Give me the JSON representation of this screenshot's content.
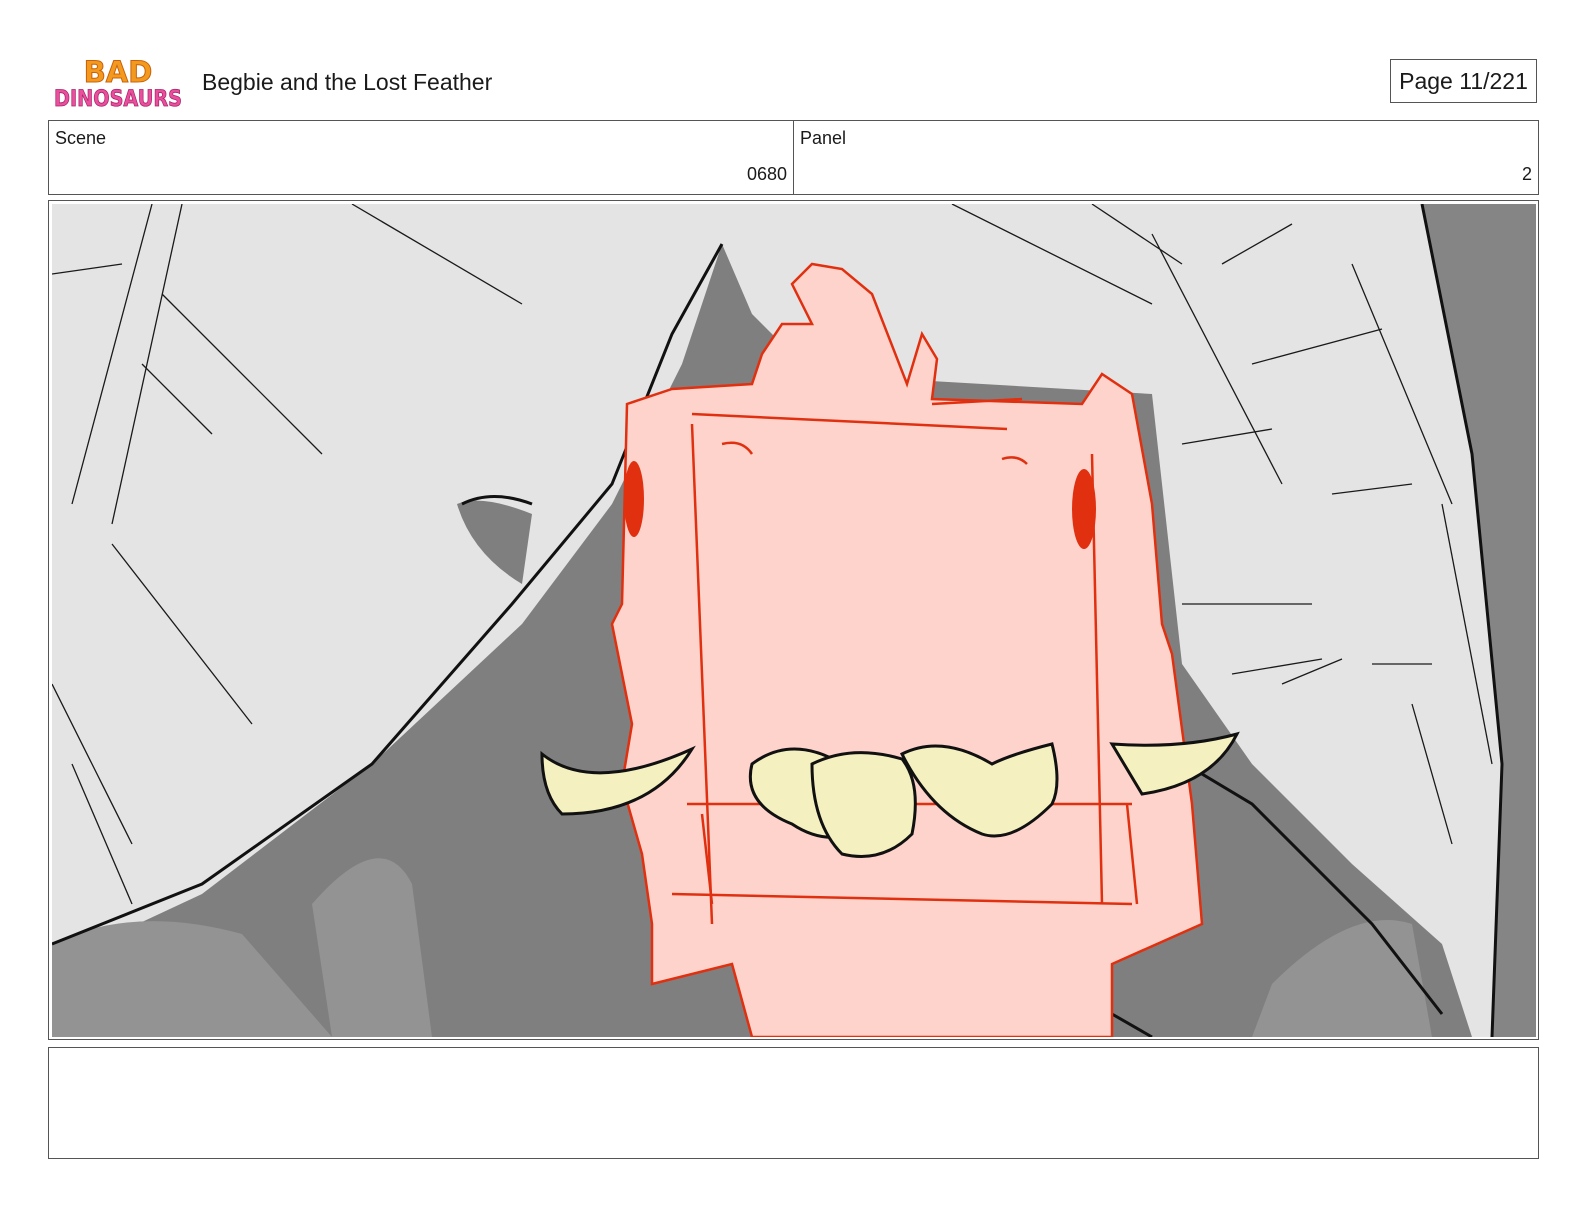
{
  "header": {
    "logo_line1": "BAD",
    "logo_line2": "DINOSAURS",
    "title": "Begbie and the Lost Feather",
    "page_label": "Page",
    "page_value": "11/221"
  },
  "meta": {
    "scene_label": "Scene",
    "scene_value": "0680",
    "panel_label": "Panel",
    "panel_value": "2"
  },
  "notes": {
    "text": ""
  },
  "colors": {
    "background_light": "#e4e4e4",
    "background_dark": "#808080",
    "creature_fill": "#fdd3cb",
    "creature_line": "#e03010",
    "teeth_fill": "#f5f0c0"
  }
}
